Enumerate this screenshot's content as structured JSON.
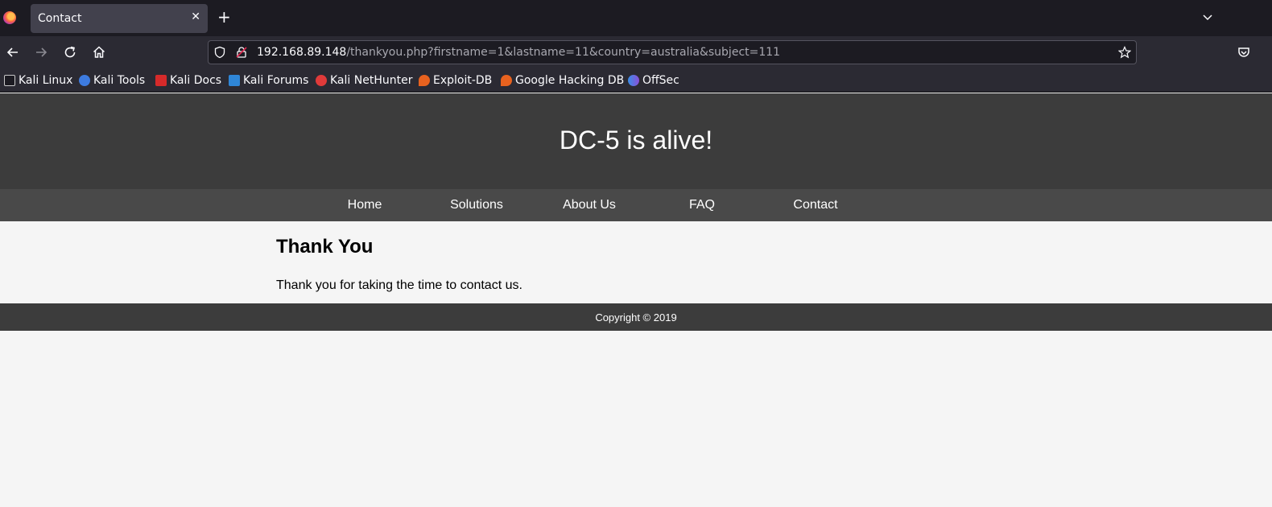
{
  "browser": {
    "tab": {
      "title": "Contact"
    },
    "url": {
      "host": "192.168.89.148",
      "path": "/thankyou.php?firstname=1&lastname=11&country=australia&subject=111"
    },
    "bookmarks": [
      {
        "label": "Kali Linux",
        "icon": "kali-dragon-icon",
        "color": "#c8c8c8"
      },
      {
        "label": "Kali Tools",
        "icon": "kali-tools-icon",
        "color": "#3d7be0"
      },
      {
        "label": "Kali Docs",
        "icon": "kali-docs-icon",
        "color": "#d62a2a"
      },
      {
        "label": "Kali Forums",
        "icon": "kali-forums-icon",
        "color": "#2f86d8"
      },
      {
        "label": "Kali NetHunter",
        "icon": "kali-nethunter-icon",
        "color": "#e03a3a"
      },
      {
        "label": "Exploit-DB",
        "icon": "exploit-db-icon",
        "color": "#e8621f"
      },
      {
        "label": "Google Hacking DB",
        "icon": "ghdb-icon",
        "color": "#e8621f"
      },
      {
        "label": "OffSec",
        "icon": "offsec-icon",
        "color": "#6a5ad8"
      }
    ]
  },
  "site": {
    "title": "DC-5 is alive!",
    "nav": [
      "Home",
      "Solutions",
      "About Us",
      "FAQ",
      "Contact"
    ],
    "heading": "Thank You",
    "message": "Thank you for taking the time to contact us.",
    "footer": "Copyright © 2019"
  },
  "colors": {
    "header_bg": "#3c3c3c",
    "nav_bg": "#494949",
    "page_bg": "#f5f5f5",
    "chrome_bg": "#2b2a33"
  }
}
